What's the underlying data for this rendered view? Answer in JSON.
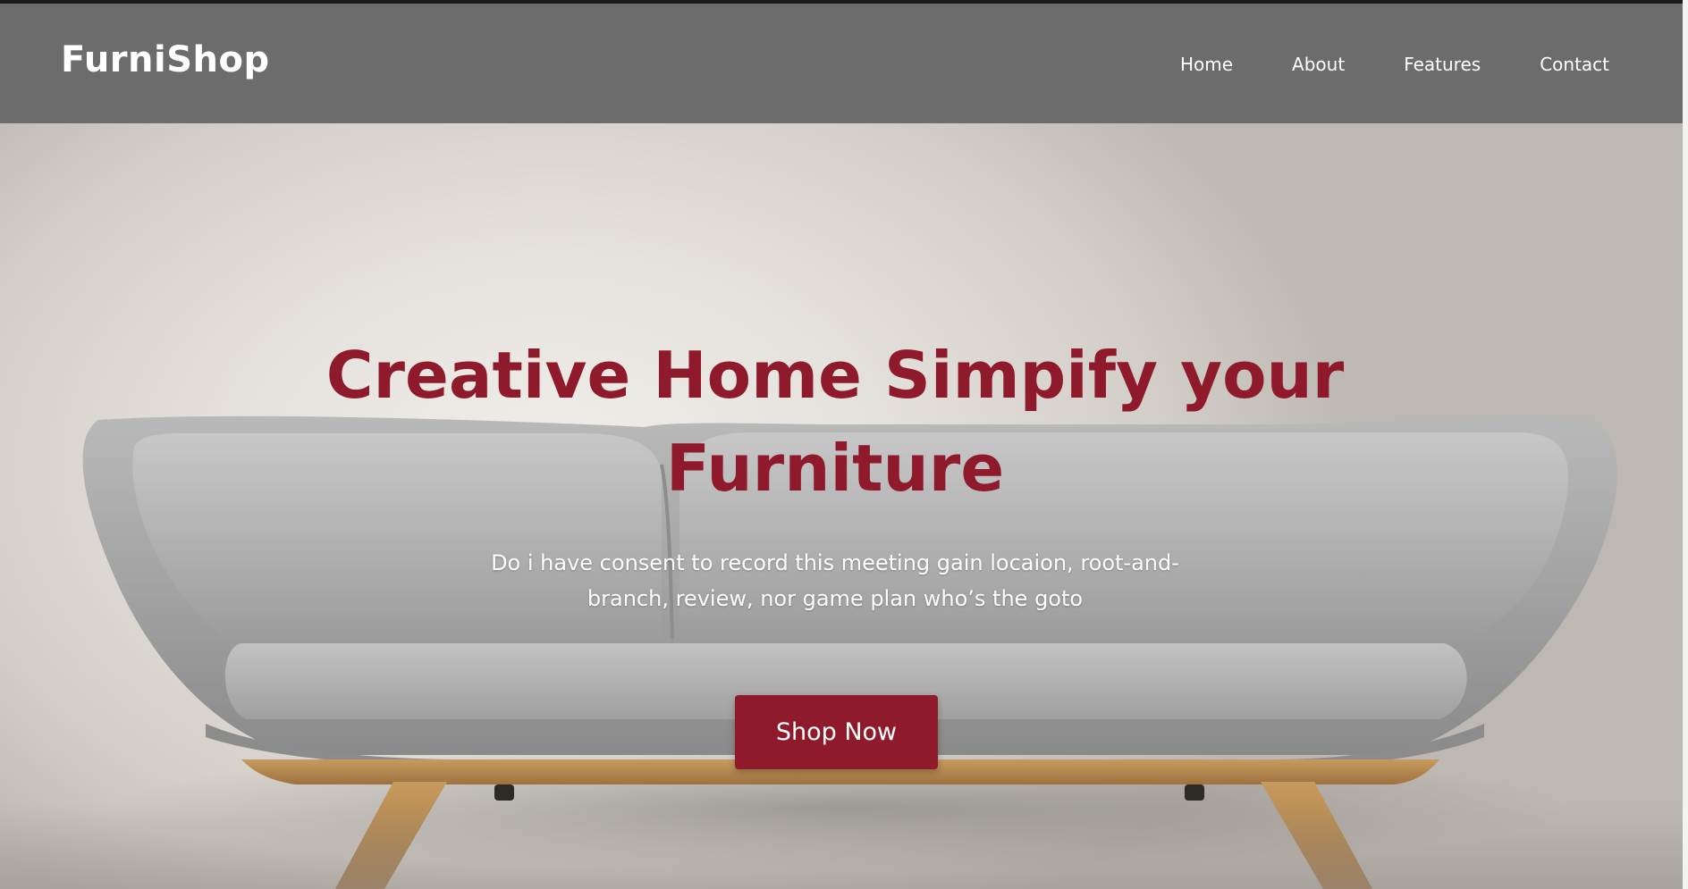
{
  "navbar": {
    "logo": "FurniShop",
    "links": [
      "Home",
      "About",
      "Features",
      "Contact"
    ]
  },
  "hero": {
    "title": "Creative Home Simpify your Furniture",
    "subtitle": "Do i have consent to record this meeting gain locaion, root-and-branch, review, nor game plan who’s the goto",
    "cta_label": "Shop Now"
  },
  "colors": {
    "accent": "#8e1a2c",
    "navbar_bg": "#6c6c6c",
    "background": "#e6e3de"
  }
}
